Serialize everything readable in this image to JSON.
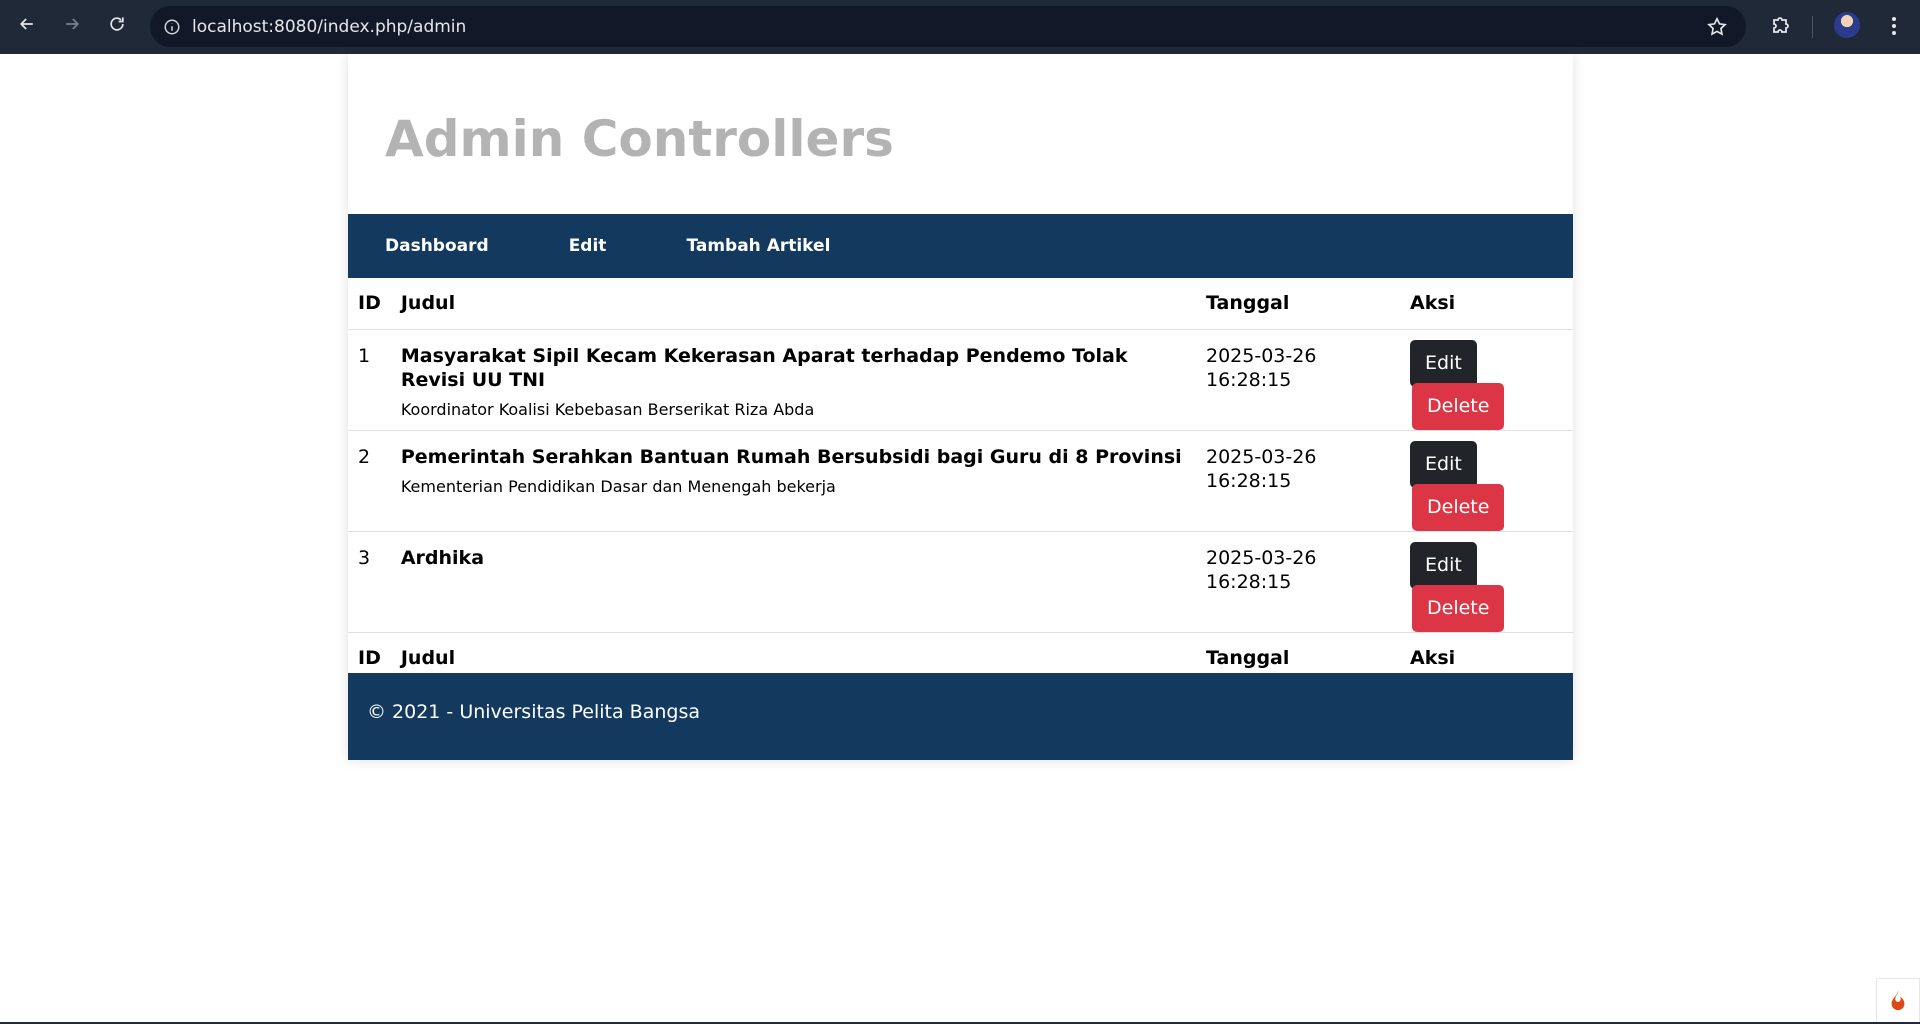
{
  "browser": {
    "url": "localhost:8080/index.php/admin"
  },
  "page": {
    "title": "Admin Controllers"
  },
  "nav": {
    "items": [
      {
        "label": "Dashboard"
      },
      {
        "label": "Edit"
      },
      {
        "label": "Tambah Artikel"
      }
    ]
  },
  "table": {
    "headers": {
      "id": "ID",
      "judul": "Judul",
      "tanggal": "Tanggal",
      "aksi": "Aksi"
    },
    "rows": [
      {
        "id": "1",
        "title": "Masyarakat Sipil Kecam Kekerasan Aparat terhadap Pendemo Tolak Revisi UU TNI",
        "summary": "Koordinator Koalisi Kebebasan Berserikat Riza Abda",
        "date": "2025-03-26 16:28:15",
        "edit_label": "Edit",
        "delete_label": "Delete"
      },
      {
        "id": "2",
        "title": "Pemerintah Serahkan Bantuan Rumah Bersubsidi bagi Guru di 8 Provinsi",
        "summary": "Kementerian Pendidikan Dasar dan Menengah bekerja",
        "date": "2025-03-26 16:28:15",
        "edit_label": "Edit",
        "delete_label": "Delete"
      },
      {
        "id": "3",
        "title": "Ardhika",
        "summary": "",
        "date": "2025-03-26 16:28:15",
        "edit_label": "Edit",
        "delete_label": "Delete"
      }
    ]
  },
  "footer": {
    "text": "© 2021 - Universitas Pelita Bangsa"
  },
  "colors": {
    "nav_bg": "#133a5e",
    "edit_btn": "#212529",
    "delete_btn": "#dc3545",
    "title": "#b3b3b3"
  },
  "icons": {
    "back": "arrow-left-icon",
    "forward": "arrow-right-icon",
    "reload": "reload-icon",
    "site_info": "info-icon",
    "bookmark": "star-icon",
    "extensions": "puzzle-icon",
    "menu": "kebab-menu-icon",
    "codeigniter": "flame-icon"
  }
}
